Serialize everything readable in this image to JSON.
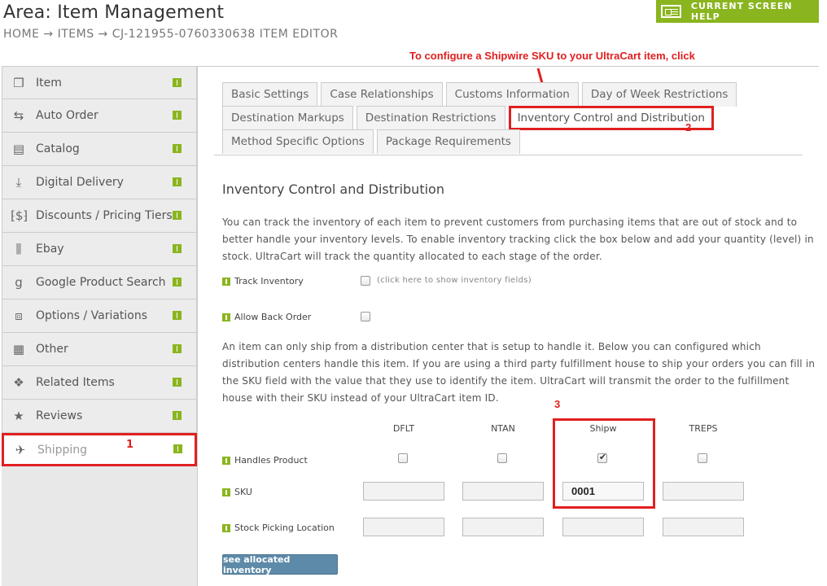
{
  "header": {
    "title": "Area: Item Management",
    "breadcrumb": "HOME → ITEMS → CJ-121955-0760330638 ITEM EDITOR",
    "help_label": "CURRENT SCREEN HELP"
  },
  "annotations": {
    "instruction": "To configure a Shipwire SKU to your UltraCart item, click",
    "step1": "1",
    "step2": "2",
    "step3": "3",
    "color": "#e02020"
  },
  "sidebar": {
    "items": [
      {
        "label": "Item",
        "icon": "cube-icon"
      },
      {
        "label": "Auto Order",
        "icon": "repeat-icon"
      },
      {
        "label": "Catalog",
        "icon": "catalog-icon"
      },
      {
        "label": "Digital Delivery",
        "icon": "download-icon"
      },
      {
        "label": "Discounts / Pricing Tiers",
        "icon": "discount-icon"
      },
      {
        "label": "Ebay",
        "icon": "columns-icon"
      },
      {
        "label": "Google Product Search",
        "icon": "google-icon"
      },
      {
        "label": "Options / Variations",
        "icon": "sliders-icon"
      },
      {
        "label": "Other",
        "icon": "list-icon"
      },
      {
        "label": "Related Items",
        "icon": "cubes-icon"
      },
      {
        "label": "Reviews",
        "icon": "star-icon"
      },
      {
        "label": "Shipping",
        "icon": "plane-icon"
      }
    ]
  },
  "tabs": {
    "row1": [
      "Basic Settings",
      "Case Relationships",
      "Customs Information",
      "Day of Week Restrictions"
    ],
    "row2": [
      "Destination Markups",
      "Destination Restrictions",
      "Inventory Control and Distribution"
    ],
    "row3": [
      "Method Specific Options",
      "Package Requirements"
    ]
  },
  "main": {
    "section_title": "Inventory Control and Distribution",
    "para1": "You can track the inventory of each item to prevent customers from purchasing items that are out of stock and to better handle your inventory levels. To enable inventory tracking click the box below and add your quantity (level) in stock. UltraCart will track the quantity allocated to each stage of the order.",
    "track_inventory_label": "Track Inventory",
    "track_inventory_hint": "(click here to show inventory fields)",
    "allow_back_order_label": "Allow Back Order",
    "para2": "An item can only ship from a distribution center that is setup to handle it. Below you can configured which distribution centers handle this item. If you are using a third party fulfillment house to ship your orders you can fill in the SKU field with the value that they use to identify the item. UltraCart will transmit the order to the fulfillment house with their SKU instead of your UltraCart item ID.",
    "columns": [
      "DFLT",
      "NTAN",
      "Shipw",
      "TREPS"
    ],
    "handles_product_label": "Handles Product",
    "sku_label": "SKU",
    "stock_picking_label": "Stock Picking Location",
    "sku_values": [
      "",
      "",
      "0001",
      ""
    ],
    "handles_checked": [
      false,
      false,
      true,
      false
    ],
    "allocated_button": "see allocated inventory"
  }
}
